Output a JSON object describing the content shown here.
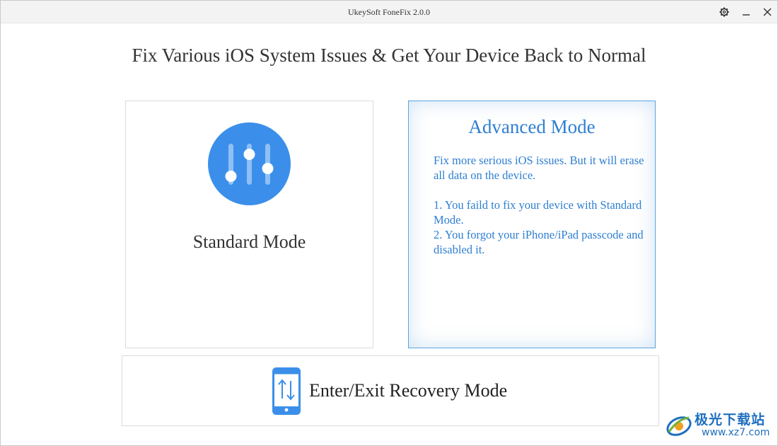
{
  "window": {
    "title": "UkeySoft FoneFix 2.0.0",
    "controls": {
      "settings_icon": "gear-icon",
      "minimize_icon": "minimize-icon",
      "close_icon": "close-icon"
    }
  },
  "main": {
    "headline": "Fix Various iOS System Issues & Get Your Device Back to Normal"
  },
  "cards": {
    "standard": {
      "title": "Standard Mode",
      "icon": "sliders-icon"
    },
    "advanced": {
      "title": "Advanced Mode",
      "desc_1": "Fix more serious iOS issues. But it will erase all data on the device.",
      "item_1": "1. You faild to fix your device with Standard Mode.",
      "item_2": "2. You forgot your iPhone/iPad passcode and disabled it."
    },
    "recovery": {
      "title": "Enter/Exit Recovery Mode",
      "icon": "phone-arrows-icon"
    }
  },
  "watermark": {
    "text_cn": "极光下载站",
    "url": "www.xz7.com",
    "icon": "xz7-logo"
  },
  "colors": {
    "accent": "#2f7fd1",
    "icon_blue": "#3b8fea",
    "text": "#333333"
  }
}
